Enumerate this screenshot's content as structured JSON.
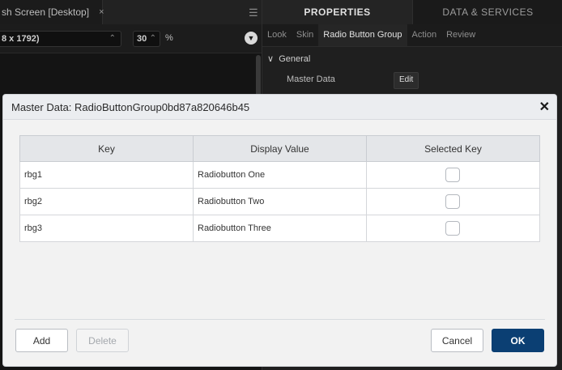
{
  "editor": {
    "tab_label": "sh Screen [Desktop]",
    "tab_close": "×",
    "menu_icon": "hamburger-icon",
    "device_value": "8 x 1792)",
    "zoom_value": "30",
    "zoom_unit": "%"
  },
  "properties": {
    "tabs": [
      "PROPERTIES",
      "DATA & SERVICES"
    ],
    "subtabs": [
      "Look",
      "Skin",
      "Radio Button Group",
      "Action",
      "Review"
    ],
    "section": "General",
    "master_data_label": "Master Data",
    "edit_label": "Edit"
  },
  "dialog": {
    "title": "Master Data: RadioButtonGroup0bd87a820646b45",
    "close": "✕",
    "columns": [
      "Key",
      "Display Value",
      "Selected Key"
    ],
    "rows": [
      {
        "key": "rbg1",
        "display": "Radiobutton One",
        "selected": false
      },
      {
        "key": "rbg2",
        "display": "Radiobutton Two",
        "selected": false
      },
      {
        "key": "rbg3",
        "display": "Radiobutton Three",
        "selected": false
      }
    ],
    "buttons": {
      "add": "Add",
      "delete": "Delete",
      "cancel": "Cancel",
      "ok": "OK"
    }
  },
  "colors": {
    "primary_button": "#0b3f73",
    "dialog_bg": "#f2f2f2",
    "ide_bg": "#141414"
  }
}
